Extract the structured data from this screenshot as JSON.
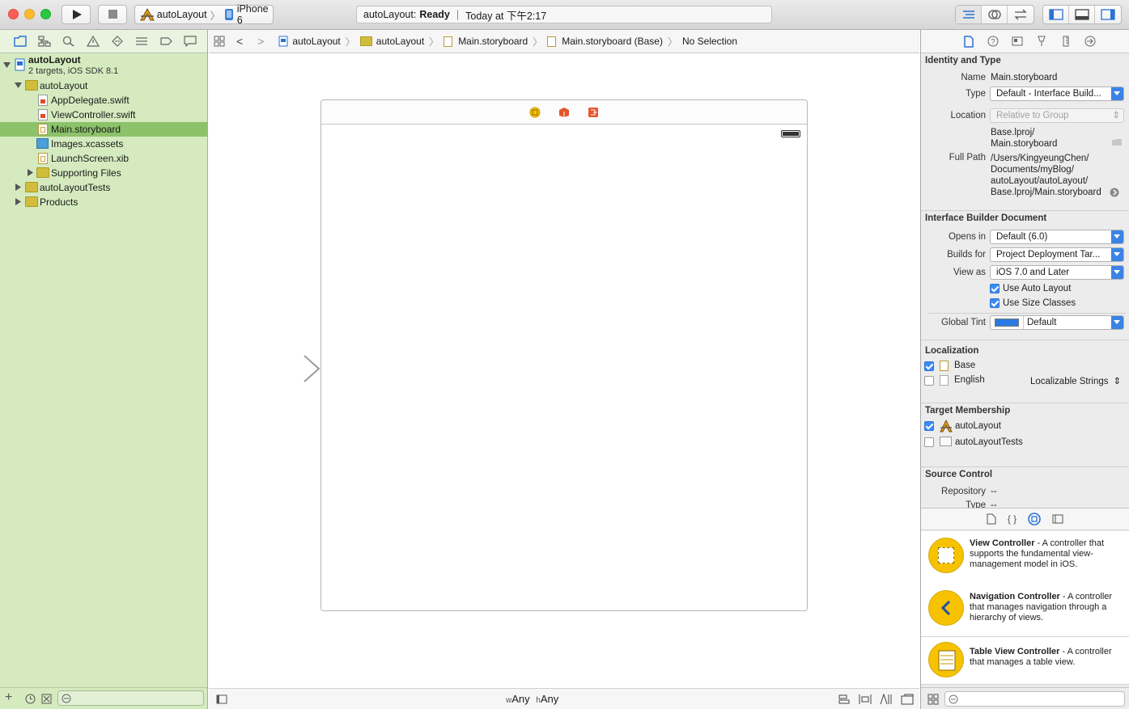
{
  "toolbar": {
    "scheme_target": "autoLayout",
    "scheme_device": "iPhone 6",
    "activity_project": "autoLayout:",
    "activity_status": "Ready",
    "activity_time": "Today at 下午2:17"
  },
  "navigator": {
    "project_name": "autoLayout",
    "project_subtitle": "2 targets, iOS SDK 8.1",
    "items": [
      {
        "label": "autoLayout",
        "kind": "folder-icon"
      },
      {
        "label": "AppDelegate.swift",
        "kind": "swift-file-icon"
      },
      {
        "label": "ViewController.swift",
        "kind": "swift-file-icon"
      },
      {
        "label": "Main.storyboard",
        "kind": "storyboard-file-icon"
      },
      {
        "label": "Images.xcassets",
        "kind": "asset-catalog-icon"
      },
      {
        "label": "LaunchScreen.xib",
        "kind": "xib-file-icon"
      },
      {
        "label": "Supporting Files",
        "kind": "folder-icon"
      },
      {
        "label": "autoLayoutTests",
        "kind": "folder-icon"
      },
      {
        "label": "Products",
        "kind": "folder-icon"
      }
    ]
  },
  "jumpbar": {
    "crumbs": [
      "autoLayout",
      "autoLayout",
      "Main.storyboard",
      "Main.storyboard (Base)",
      "No Selection"
    ]
  },
  "editor": {
    "size_class_w_prefix": "w",
    "size_class_w": "Any",
    "size_class_h_prefix": "h",
    "size_class_h": "Any"
  },
  "inspector": {
    "identity_title": "Identity and Type",
    "name_label": "Name",
    "name_value": "Main.storyboard",
    "type_label": "Type",
    "type_value": "Default - Interface Build...",
    "location_label": "Location",
    "location_value": "Relative to Group",
    "location_path_1": "Base.lproj/",
    "location_path_2": "Main.storyboard",
    "fullpath_label": "Full Path",
    "fullpath_1": "/Users/KingyeungChen/",
    "fullpath_2": "Documents/myBlog/",
    "fullpath_3": "autoLayout/autoLayout/",
    "fullpath_4": "Base.lproj/Main.storyboard",
    "ib_title": "Interface Builder Document",
    "opens_label": "Opens in",
    "opens_value": "Default (6.0)",
    "builds_label": "Builds for",
    "builds_value": "Project Deployment Tar...",
    "viewas_label": "View as",
    "viewas_value": "iOS 7.0 and Later",
    "autolayout_label": "Use Auto Layout",
    "sizeclasses_label": "Use Size Classes",
    "tint_label": "Global Tint",
    "tint_value": "Default",
    "tint_color": "#2a7ae2",
    "localization_title": "Localization",
    "loc_base": "Base",
    "loc_english": "English",
    "loc_english_type": "Localizable Strings",
    "membership_title": "Target Membership",
    "target_1": "autoLayout",
    "target_2": "autoLayoutTests",
    "source_title": "Source Control",
    "repo_label": "Repository",
    "repo_value": "--",
    "type2_label": "Type",
    "type2_value": "--"
  },
  "library": {
    "items": [
      {
        "title": "View Controller",
        "desc": " - A controller that supports the fundamental view-management model in iOS."
      },
      {
        "title": "Navigation Controller",
        "desc": " - A controller that manages navigation through a hierarchy of views."
      },
      {
        "title": "Table View Controller",
        "desc": " - A controller that manages a table view."
      }
    ]
  },
  "colors": {
    "navigator_bg": "#d5ebbf",
    "selection": "#8cc26a",
    "accent": "#3b8bf5"
  }
}
